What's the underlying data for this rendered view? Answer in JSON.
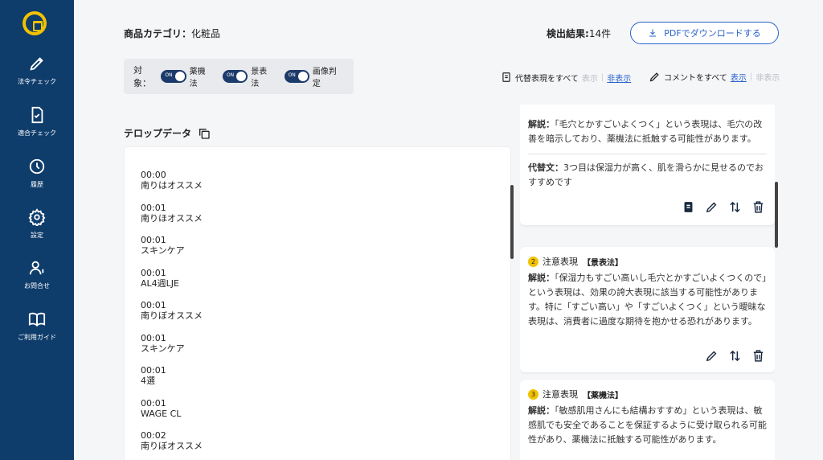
{
  "sidebar": {
    "items": [
      {
        "label": "法令チェック",
        "icon": "pencil-icon"
      },
      {
        "label": "適合チェック",
        "icon": "document-check-icon"
      },
      {
        "label": "履歴",
        "icon": "history-icon"
      },
      {
        "label": "設定",
        "icon": "gear-icon"
      },
      {
        "label": "お問合せ",
        "icon": "contact-icon"
      },
      {
        "label": "ご利用ガイド",
        "icon": "book-icon"
      }
    ]
  },
  "header": {
    "category_label": "商品カテゴリ：",
    "category_value": "化粧品",
    "results_label": "検出結果:",
    "results_value": "14件",
    "pdf_button": "PDFでダウンロードする"
  },
  "filters": {
    "target_label": "対象：",
    "toggle_on_text": "ON",
    "toggles": [
      {
        "label": "薬機法"
      },
      {
        "label": "景表法"
      },
      {
        "label": "画像判定"
      }
    ]
  },
  "display_controls": {
    "alt_label": "代替表現をすべて",
    "alt_show": "表示",
    "alt_hide": "非表示",
    "comment_label": "コメントをすべて",
    "comment_show": "表示",
    "comment_hide": "非表示"
  },
  "telop": {
    "title": "テロップデータ",
    "entries": [
      {
        "time": "00:00",
        "text": "南りはオススメ"
      },
      {
        "time": "00:01",
        "text": "南りほオススメ"
      },
      {
        "time": "00:01",
        "text": "スキンケア"
      },
      {
        "time": "00:01",
        "text": "AL4週LJE"
      },
      {
        "time": "00:01",
        "text": "南りぼオススメ"
      },
      {
        "time": "00:01",
        "text": "スキンケア"
      },
      {
        "time": "00:01",
        "text": "4選"
      },
      {
        "time": "00:01",
        "text": "WAGE CL"
      },
      {
        "time": "00:02",
        "text": "南りぼオススメ"
      }
    ]
  },
  "results_cards": {
    "card1": {
      "explanation_label": "解説：",
      "explanation": "「毛穴とかすごいよくつく」という表現は、毛穴の改善を暗示しており、薬機法に抵触する可能性があります。",
      "alt_label": "代替文：",
      "alt_text": "3つ目は保湿力が高く、肌を滑らかに見せるのでおすすめです"
    },
    "card2": {
      "number": "2",
      "type": "注意表現",
      "law": "【景表法】",
      "explanation_label": "解説：",
      "explanation": "「保湿力もすごい高いし毛穴とかすごいよくつくので」という表現は、効果の誇大表現に該当する可能性があります。特に「すごい高い」や「すごいよくつく」という曖昧な表現は、消費者に過度な期待を抱かせる恐れがあります。"
    },
    "card3": {
      "number": "3",
      "type": "注意表現",
      "law": "【薬機法】",
      "explanation_label": "解説：",
      "explanation": "「敏感肌用さんにも結構おすすめ」という表現は、敏感肌でも安全であることを保証するように受け取られる可能性があり、薬機法に抵触する可能性があります。"
    }
  },
  "colors": {
    "sidebar": "#0e3c6b",
    "accent": "#2a62c9",
    "badge": "#f2c200",
    "toggle": "#1c3a6b"
  }
}
